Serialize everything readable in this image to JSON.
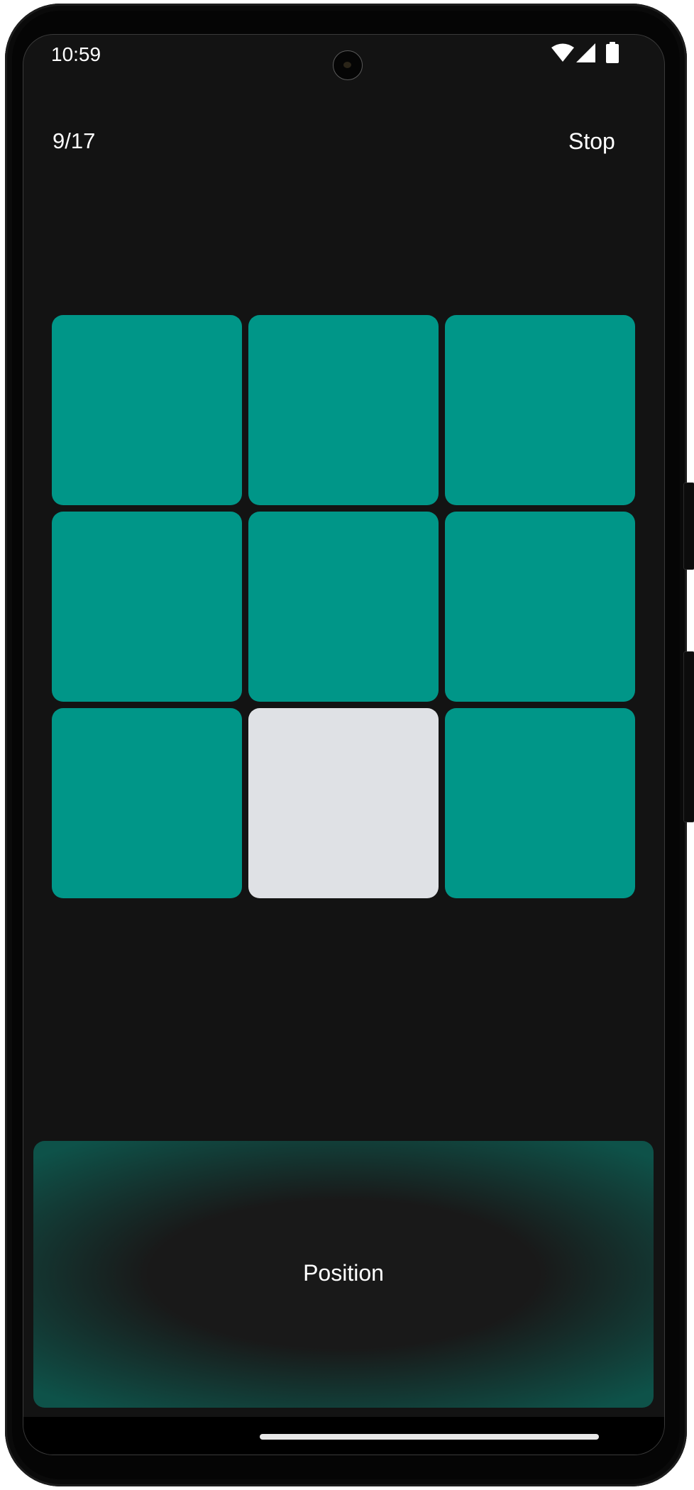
{
  "status_bar": {
    "time": "10:59",
    "icons": [
      "wifi-icon",
      "cell-signal-icon",
      "battery-icon"
    ]
  },
  "header": {
    "progress": "9/17",
    "stop_label": "Stop"
  },
  "grid": {
    "rows": 3,
    "cols": 3,
    "tile_color": "#009688",
    "active_color": "#dfe1e5",
    "active_index": 7,
    "tiles": [
      {
        "row": 1,
        "col": 1,
        "active": false
      },
      {
        "row": 1,
        "col": 2,
        "active": false
      },
      {
        "row": 1,
        "col": 3,
        "active": false
      },
      {
        "row": 2,
        "col": 1,
        "active": false
      },
      {
        "row": 2,
        "col": 2,
        "active": false
      },
      {
        "row": 2,
        "col": 3,
        "active": false
      },
      {
        "row": 3,
        "col": 1,
        "active": false
      },
      {
        "row": 3,
        "col": 2,
        "active": true
      },
      {
        "row": 3,
        "col": 3,
        "active": false
      }
    ]
  },
  "position_button": {
    "label": "Position",
    "accent": "#0e5249"
  },
  "colors": {
    "background": "#131313",
    "text": "#ffffff"
  }
}
